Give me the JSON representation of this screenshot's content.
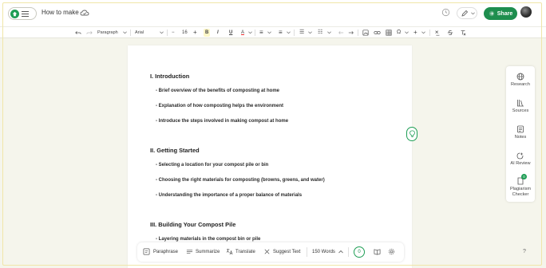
{
  "header": {
    "title": "How to make",
    "share_label": "Share"
  },
  "toolbar": {
    "paragraph_style": "Paragraph",
    "font_family": "Arial",
    "font_size": "16",
    "minus": "−",
    "plus": "+",
    "bold": "B",
    "italic": "I",
    "underline": "U",
    "strike_color": "A",
    "align": "≡",
    "line_spacing": "≡",
    "bullet_list": "☰",
    "num_list": "☷",
    "omega": "Ω",
    "insert": "+"
  },
  "document": {
    "sections": [
      {
        "heading": "I. Introduction",
        "bullets": [
          "- Brief overview of the benefits of composting at home",
          "- Explanation of how composting helps the environment",
          "- Introduce the steps involved in making compost at home"
        ]
      },
      {
        "heading": "II. Getting Started",
        "bullets": [
          "- Selecting a location for your compost pile or bin",
          "- Choosing the right materials for composting (browns, greens, and water)",
          "- Understanding the importance of a proper balance of materials"
        ]
      },
      {
        "heading": "III. Building Your Compost Pile",
        "bullets": [
          "- Layering materials in the compost bin or pile"
        ]
      }
    ]
  },
  "right_panel": {
    "items": [
      {
        "label": "Research",
        "icon": "globe-icon"
      },
      {
        "label": "Sources",
        "icon": "books-icon"
      },
      {
        "label": "Notes",
        "icon": "notes-icon"
      },
      {
        "label": "AI Review",
        "icon": "ai-review-icon"
      },
      {
        "label": "Plagiarism Checker",
        "icon": "plagiarism-icon"
      }
    ],
    "plagiarism_badge": "0"
  },
  "bottom_bar": {
    "paraphrase": "Paraphrase",
    "summarize": "Summarize",
    "translate": "Translate",
    "suggest_text": "Suggest Text",
    "word_count": "150 Words",
    "issues_count": "0"
  },
  "help_label": "?",
  "colors": {
    "accent": "#1e8e4e",
    "page_bg": "#f5f5ec"
  }
}
